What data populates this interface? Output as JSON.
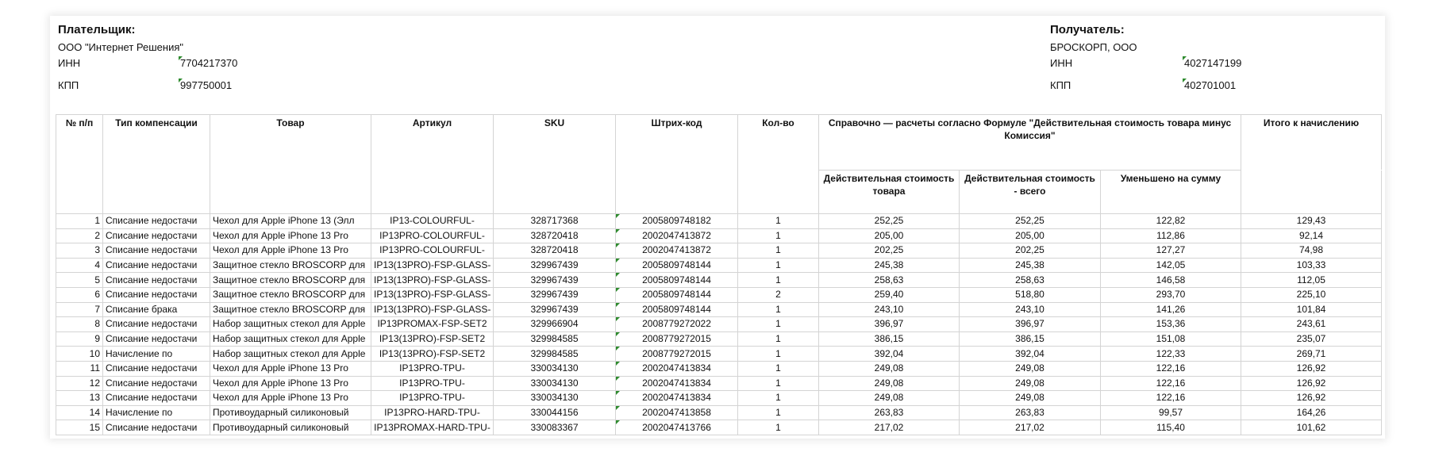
{
  "payer": {
    "title": "Плательщик:",
    "name": "ООО \"Интернет Решения\"",
    "inn_label": "ИНН",
    "inn": "7704217370",
    "kpp_label": "КПП",
    "kpp": "997750001"
  },
  "recipient": {
    "title": "Получатель:",
    "name": "БРОСКОРП, ООО",
    "inn_label": "ИНН",
    "inn": "4027147199",
    "kpp_label": "КПП",
    "kpp": "402701001"
  },
  "headers": {
    "num": "№ п/п",
    "type": "Тип компенсации",
    "product": "Товар",
    "article": "Артикул",
    "sku": "SKU",
    "barcode": "Штрих-код",
    "qty": "Кол-во",
    "reference": "Справочно — расчеты согласно Формуле \"Действительная стоимость товара минус Комиссия\"",
    "actual_price": "Действительная стоимость товара",
    "actual_total": "Действительная стоимость - всего",
    "reduced": "Уменьшено на сумму",
    "total": "Итого к начислению"
  },
  "rows": [
    {
      "n": "1",
      "type": "Списание недостачи",
      "product": "Чехол для Apple iPhone 13 (Элл",
      "article": "IP13-COLOURFUL-",
      "sku": "328717368",
      "barcode": "2005809748182",
      "qty": "1",
      "price": "252,25",
      "total_price": "252,25",
      "reduced": "122,82",
      "total": "129,43"
    },
    {
      "n": "2",
      "type": "Списание недостачи",
      "product": "Чехол для Apple iPhone 13 Pro",
      "article": "IP13PRO-COLOURFUL-",
      "sku": "328720418",
      "barcode": "2002047413872",
      "qty": "1",
      "price": "205,00",
      "total_price": "205,00",
      "reduced": "112,86",
      "total": "92,14"
    },
    {
      "n": "3",
      "type": "Списание недостачи",
      "product": "Чехол для Apple iPhone 13 Pro",
      "article": "IP13PRO-COLOURFUL-",
      "sku": "328720418",
      "barcode": "2002047413872",
      "qty": "1",
      "price": "202,25",
      "total_price": "202,25",
      "reduced": "127,27",
      "total": "74,98"
    },
    {
      "n": "4",
      "type": "Списание недостачи",
      "product": "Защитное стекло BROSCORP для",
      "article": "IP13(13PRO)-FSP-GLASS-",
      "sku": "329967439",
      "barcode": "2005809748144",
      "qty": "1",
      "price": "245,38",
      "total_price": "245,38",
      "reduced": "142,05",
      "total": "103,33"
    },
    {
      "n": "5",
      "type": "Списание недостачи",
      "product": "Защитное стекло BROSCORP для",
      "article": "IP13(13PRO)-FSP-GLASS-",
      "sku": "329967439",
      "barcode": "2005809748144",
      "qty": "1",
      "price": "258,63",
      "total_price": "258,63",
      "reduced": "146,58",
      "total": "112,05"
    },
    {
      "n": "6",
      "type": "Списание недостачи",
      "product": "Защитное стекло BROSCORP для",
      "article": "IP13(13PRO)-FSP-GLASS-",
      "sku": "329967439",
      "barcode": "2005809748144",
      "qty": "2",
      "price": "259,40",
      "total_price": "518,80",
      "reduced": "293,70",
      "total": "225,10"
    },
    {
      "n": "7",
      "type": "Списание брака",
      "product": "Защитное стекло BROSCORP для",
      "article": "IP13(13PRO)-FSP-GLASS-",
      "sku": "329967439",
      "barcode": "2005809748144",
      "qty": "1",
      "price": "243,10",
      "total_price": "243,10",
      "reduced": "141,26",
      "total": "101,84"
    },
    {
      "n": "8",
      "type": "Списание недостачи",
      "product": "Набор защитных стекол для Apple",
      "article": "IP13PROMAX-FSP-SET2",
      "sku": "329966904",
      "barcode": "2008779272022",
      "qty": "1",
      "price": "396,97",
      "total_price": "396,97",
      "reduced": "153,36",
      "total": "243,61"
    },
    {
      "n": "9",
      "type": "Списание недостачи",
      "product": "Набор защитных стекол для Apple",
      "article": "IP13(13PRO)-FSP-SET2",
      "sku": "329984585",
      "barcode": "2008779272015",
      "qty": "1",
      "price": "386,15",
      "total_price": "386,15",
      "reduced": "151,08",
      "total": "235,07"
    },
    {
      "n": "10",
      "type": "Начисление по",
      "product": "Набор защитных стекол для Apple",
      "article": "IP13(13PRO)-FSP-SET2",
      "sku": "329984585",
      "barcode": "2008779272015",
      "qty": "1",
      "price": "392,04",
      "total_price": "392,04",
      "reduced": "122,33",
      "total": "269,71"
    },
    {
      "n": "11",
      "type": "Списание недостачи",
      "product": "Чехол для Apple iPhone 13 Pro",
      "article": "IP13PRO-TPU-",
      "sku": "330034130",
      "barcode": "2002047413834",
      "qty": "1",
      "price": "249,08",
      "total_price": "249,08",
      "reduced": "122,16",
      "total": "126,92"
    },
    {
      "n": "12",
      "type": "Списание недостачи",
      "product": "Чехол для Apple iPhone 13 Pro",
      "article": "IP13PRO-TPU-",
      "sku": "330034130",
      "barcode": "2002047413834",
      "qty": "1",
      "price": "249,08",
      "total_price": "249,08",
      "reduced": "122,16",
      "total": "126,92"
    },
    {
      "n": "13",
      "type": "Списание недостачи",
      "product": "Чехол для Apple iPhone 13 Pro",
      "article": "IP13PRO-TPU-",
      "sku": "330034130",
      "barcode": "2002047413834",
      "qty": "1",
      "price": "249,08",
      "total_price": "249,08",
      "reduced": "122,16",
      "total": "126,92"
    },
    {
      "n": "14",
      "type": "Начисление по",
      "product": "Противоударный силиконовый",
      "article": "IP13PRO-HARD-TPU-",
      "sku": "330044156",
      "barcode": "2002047413858",
      "qty": "1",
      "price": "263,83",
      "total_price": "263,83",
      "reduced": "99,57",
      "total": "164,26"
    },
    {
      "n": "15",
      "type": "Списание недостачи",
      "product": "Противоударный силиконовый",
      "article": "IP13PROMAX-HARD-TPU-",
      "sku": "330083367",
      "barcode": "2002047413766",
      "qty": "1",
      "price": "217,02",
      "total_price": "217,02",
      "reduced": "115,40",
      "total": "101,62"
    }
  ]
}
